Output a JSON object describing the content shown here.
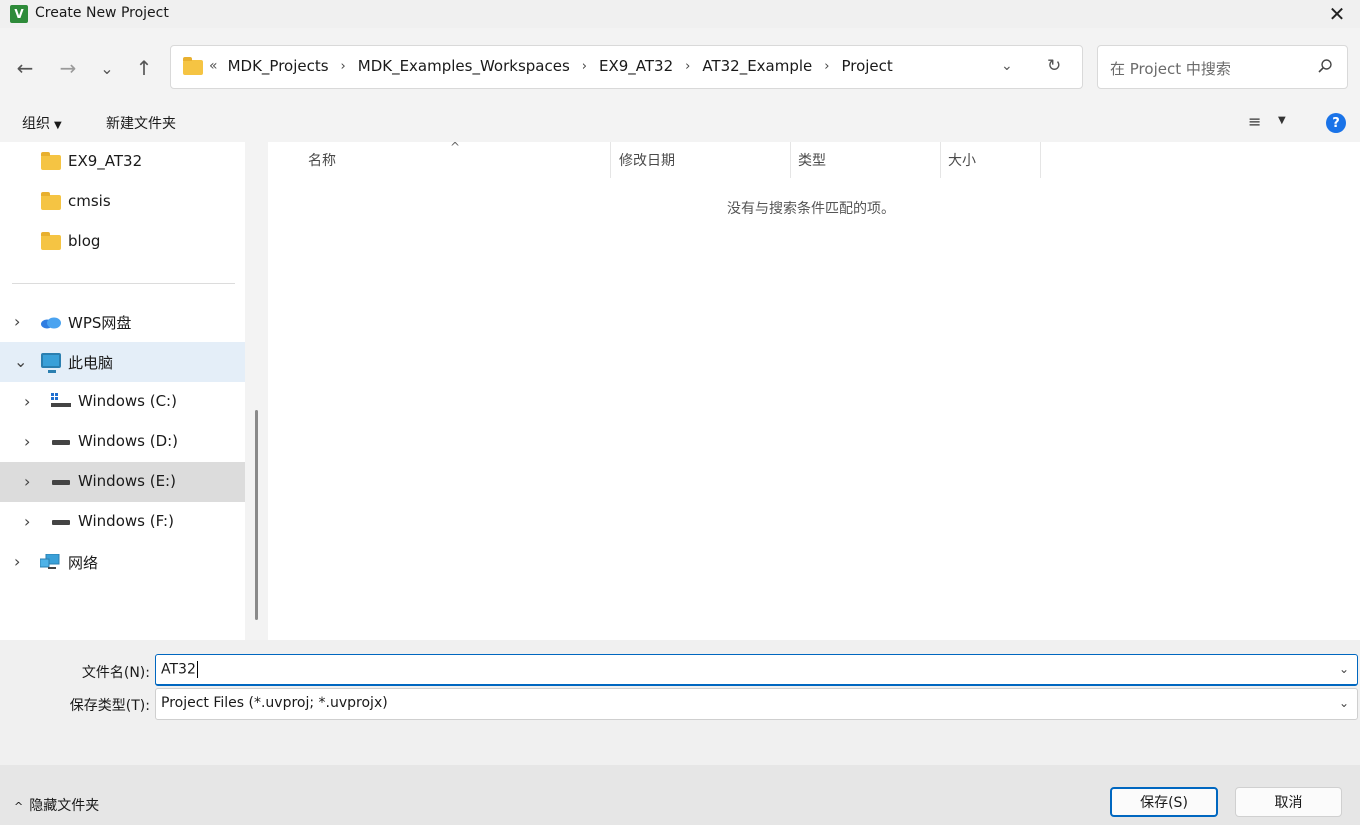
{
  "window": {
    "title": "Create New Project",
    "app_icon_letter": "V",
    "close_glyph": "✕"
  },
  "nav": {
    "back_glyph": "←",
    "forward_glyph": "→",
    "recent_glyph": "⌄",
    "up_glyph": "↑"
  },
  "address": {
    "more_glyph": "«",
    "crumbs": [
      "MDK_Projects",
      "MDK_Examples_Workspaces",
      "EX9_AT32",
      "AT32_Example",
      "Project"
    ],
    "separator": "›",
    "dropdown_glyph": "⌄",
    "refresh_glyph": "↻"
  },
  "search": {
    "placeholder": "在 Project 中搜索"
  },
  "toolbar": {
    "organize_label": "组织",
    "organize_caret": "▼",
    "new_folder_label": "新建文件夹",
    "view_glyph": "≡",
    "view_caret": "▼",
    "help_glyph": "?"
  },
  "sidebar": {
    "folders": [
      {
        "label": "EX9_AT32"
      },
      {
        "label": "cmsis"
      },
      {
        "label": "blog"
      }
    ],
    "locations": [
      {
        "label": "WPS网盘",
        "chevron": "›"
      },
      {
        "label": "此电脑",
        "chevron": "⌄"
      }
    ],
    "drives": [
      {
        "label": "Windows (C:)",
        "chevron": "›"
      },
      {
        "label": "Windows (D:)",
        "chevron": "›"
      },
      {
        "label": "Windows (E:)",
        "chevron": "›"
      },
      {
        "label": "Windows (F:)",
        "chevron": "›"
      }
    ],
    "network": {
      "label": "网络",
      "chevron": "›"
    }
  },
  "file_list": {
    "sort_glyph": "^",
    "columns": [
      "名称",
      "修改日期",
      "类型",
      "大小"
    ],
    "empty_message": "没有与搜索条件匹配的项。"
  },
  "form": {
    "filename_label": "文件名(N):",
    "filename_value": "AT32",
    "filetype_label": "保存类型(T):",
    "filetype_value": "Project Files (*.uvproj; *.uvprojx)",
    "dropdown_glyph": "⌄"
  },
  "footer": {
    "hide_folders_caret": "^",
    "hide_folders_label": "隐藏文件夹",
    "save_label": "保存(S)",
    "cancel_label": "取消"
  }
}
